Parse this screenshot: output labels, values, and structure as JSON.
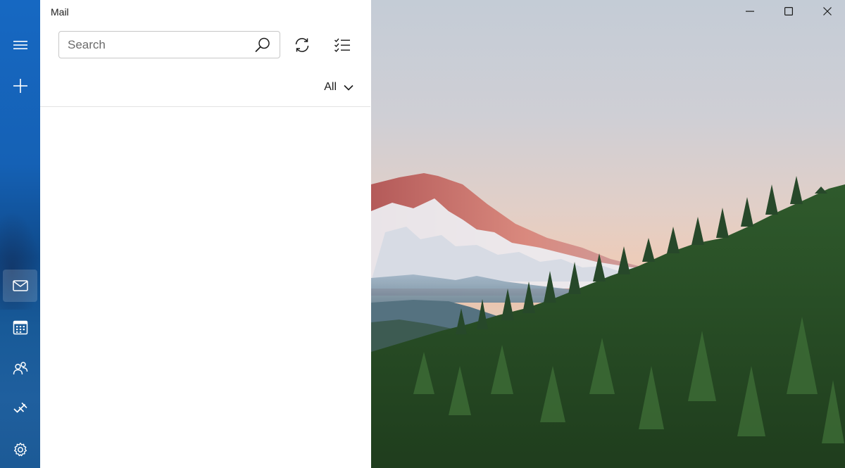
{
  "app": {
    "title": "Mail"
  },
  "search": {
    "placeholder": "Search",
    "value": ""
  },
  "toolbar": {
    "sync_icon": "sync-icon",
    "select_icon": "select-mode-icon"
  },
  "filter": {
    "label": "All"
  },
  "nav": {
    "items": [
      {
        "name": "menu",
        "icon": "hamburger-icon"
      },
      {
        "name": "new-mail",
        "icon": "plus-icon"
      },
      {
        "name": "mail",
        "icon": "mail-icon",
        "active": true
      },
      {
        "name": "calendar",
        "icon": "calendar-icon"
      },
      {
        "name": "people",
        "icon": "people-icon"
      },
      {
        "name": "to-do",
        "icon": "todo-icon"
      },
      {
        "name": "settings",
        "icon": "gear-icon"
      }
    ]
  },
  "window": {
    "controls": [
      "minimize",
      "maximize",
      "close"
    ]
  },
  "colors": {
    "rail": "#1668c2",
    "pane": "#ffffff",
    "text": "#1b1b1b",
    "border": "#c7c7c7"
  }
}
